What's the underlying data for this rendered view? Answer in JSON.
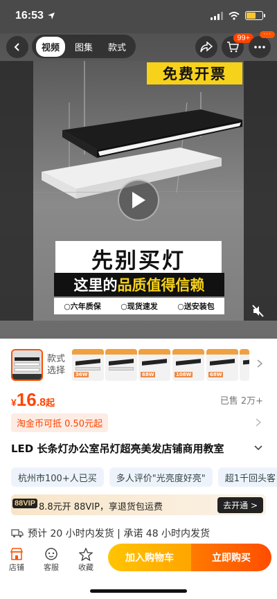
{
  "status_bar": {
    "time": "16:53"
  },
  "top_nav": {
    "tabs": [
      {
        "label": "视频",
        "active": true
      },
      {
        "label": "图集",
        "active": false
      },
      {
        "label": "款式",
        "active": false
      }
    ],
    "cart_badge": "99+",
    "more_badge": "···"
  },
  "media": {
    "banner_top": "免费开票",
    "headline": "先别买灯",
    "subline_prefix": "这里的",
    "subline_highlight": "品质值得信赖",
    "features": [
      "○六年质保",
      "○现货速发",
      "○送安装包"
    ]
  },
  "style_picker": {
    "label": "款式选择",
    "thumb_tags": [
      "36W",
      "68W",
      "108W",
      "68W",
      "36W"
    ]
  },
  "price": {
    "currency": "¥",
    "integer": "16",
    "decimal": ".8",
    "suffix": "起",
    "sold": "已售 2万+"
  },
  "coin_offer": "淘金币可抵 0.50元起",
  "product_title": "LED 长条灯办公室吊灯超亮美发店铺商用教室",
  "tags": [
    "杭州市100+人已买",
    "多人评价\"光亮度好亮\"",
    "超1千回头客"
  ],
  "vip": {
    "badge": "88VIP",
    "text": "8.8元开 88VIP，享退货包运费",
    "button": "去开通 >"
  },
  "shipping": {
    "text": "预计 20 小时内发货 | 承诺 48 小时内发货"
  },
  "bottom_bar": {
    "shop": "店铺",
    "service": "客服",
    "favorite": "收藏",
    "add_to_cart": "加入购物车",
    "buy_now": "立即购买"
  },
  "colors": {
    "accent": "#ff4400",
    "banner_yellow": "#f7d21a",
    "cart_btn": "#ffb000",
    "buy_btn": "#ff5a00"
  }
}
